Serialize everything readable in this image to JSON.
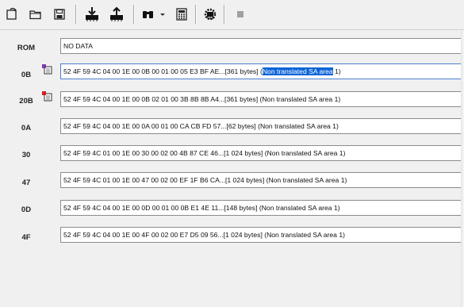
{
  "toolbar": {
    "buttons": [
      {
        "name": "refresh-icon"
      },
      {
        "name": "open-folder-icon"
      },
      {
        "name": "save-icon"
      },
      {
        "name": "read-chip-icon"
      },
      {
        "name": "write-chip-icon"
      },
      {
        "name": "binoculars-icon"
      },
      {
        "name": "calculator-icon"
      },
      {
        "name": "settings-chip-icon"
      },
      {
        "name": "stop-icon"
      }
    ]
  },
  "rows": [
    {
      "label": "ROM",
      "value": "NO DATA",
      "has_icon": false
    },
    {
      "label": "0B",
      "value_before": "52 4F 59 4C 04 00 1E 00 0B 00 01 00 05 E3 BF AE...[361 bytes] (",
      "value_selected": "Non translated SA area",
      "value_after": " 1)",
      "has_icon": true,
      "icon_color": "#7a3aa8"
    },
    {
      "label": "20B",
      "value": "52 4F 59 4C 04 00 1E 00 0B 02 01 00 3B 8B 8B A4...[361 bytes] (Non translated SA area 1)",
      "has_icon": true,
      "icon_color": "#d02020"
    },
    {
      "label": "0A",
      "value": "52 4F 59 4C 04 00 1E 00 0A 00 01 00 CA CB FD 57...[62 bytes] (Non translated SA area 1)",
      "has_icon": false
    },
    {
      "label": "30",
      "value": "52 4F 59 4C 01 00 1E 00 30 00 02 00 4B 87 CE 46...[1 024 bytes] (Non translated SA area 1)",
      "has_icon": false
    },
    {
      "label": "47",
      "value": "52 4F 59 4C 01 00 1E 00 47 00 02 00 EF 1F B6 CA...[1 024 bytes] (Non translated SA area 1)",
      "has_icon": false
    },
    {
      "label": "0D",
      "value": "52 4F 59 4C 04 00 1E 00 0D 00 01 00 0B E1 4E 11...[148 bytes] (Non translated SA area 1)",
      "has_icon": false
    },
    {
      "label": "4F",
      "value": "52 4F 59 4C 04 00 1E 00 4F 00 02 00 E7 D5 09 56...[1 024 bytes] (Non translated SA area 1)",
      "has_icon": false
    }
  ],
  "colors": {
    "selection": "#0a64d8",
    "field_border": "#8c8c8c"
  }
}
